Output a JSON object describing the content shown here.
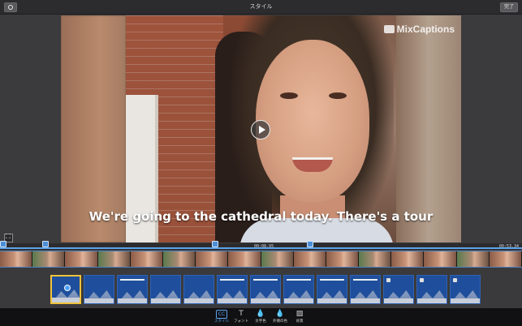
{
  "header": {
    "title": "スタイル",
    "done_label": "完了"
  },
  "preview": {
    "watermark": "MixCaptions",
    "caption_text": "We're going to the cathedral today. There's a tour"
  },
  "timeline": {
    "current_time": "00:08.95",
    "end_time": "00:53.34"
  },
  "toolbar": {
    "tabs": [
      {
        "label": "スタイル",
        "glyph": "CC",
        "icon": "captions-icon",
        "active": true
      },
      {
        "label": "フォント",
        "glyph": "T",
        "icon": "font-icon",
        "active": false
      },
      {
        "label": "文字色",
        "glyph": "💧",
        "icon": "text-color-icon",
        "active": false
      },
      {
        "label": "外側の色",
        "glyph": "💧",
        "icon": "outline-color-icon",
        "active": false
      },
      {
        "label": "背景",
        "glyph": "▨",
        "icon": "background-icon",
        "active": false
      }
    ]
  },
  "colors": {
    "accent": "#5aa3f0",
    "selection": "#f0c23a",
    "template_bg": "#1f4f9c"
  }
}
